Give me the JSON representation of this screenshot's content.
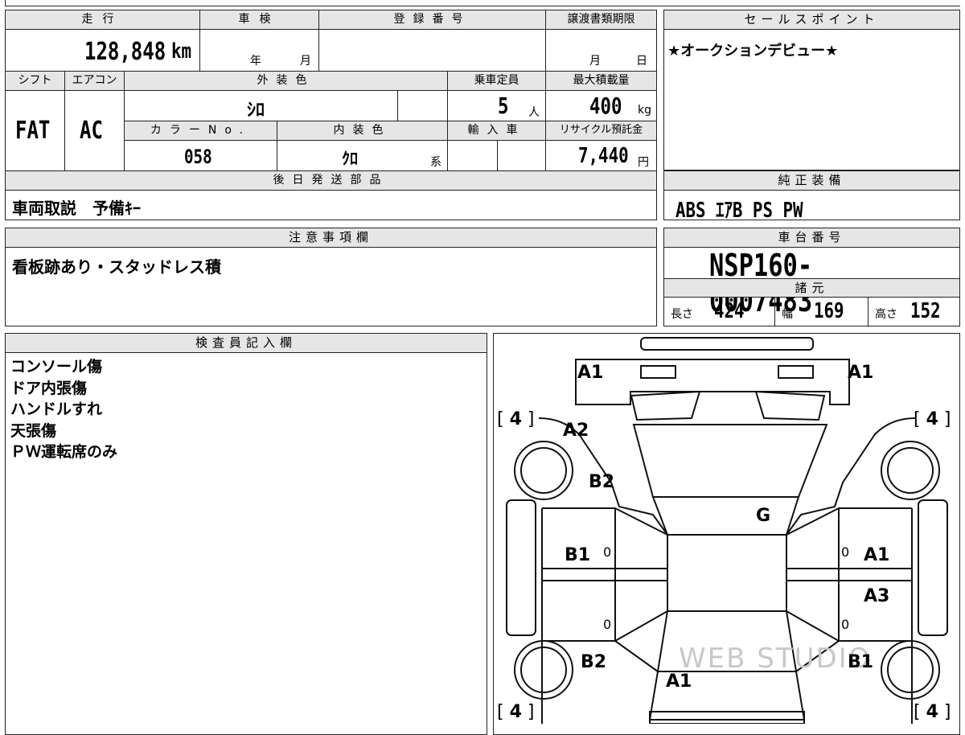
{
  "top_strip": {},
  "info": {
    "mileage_label": "走行",
    "mileage_value": "128,848",
    "mileage_unit": "km",
    "shaken_label": "車検",
    "shaken_year": "年",
    "shaken_month": "月",
    "reg_label": "登録番号",
    "transfer_label": "譲渡書類期限",
    "transfer_month": "月",
    "transfer_day": "日",
    "shift_label": "シフト",
    "shift_value": "FAT",
    "ac_label": "エアコン",
    "ac_value": "AC",
    "ext_color_label": "外装色",
    "ext_color_value": "ｼﾛ",
    "capacity_label": "乗車定員",
    "capacity_value": "5",
    "capacity_unit": "人",
    "load_label": "最大積載量",
    "load_value": "400",
    "load_unit": "kg",
    "color_no_label": "カラーNo.",
    "color_no_value": "058",
    "int_color_label": "内装色",
    "int_color_value": "ｸﾛ",
    "int_color_suffix": "系",
    "import_label": "輸入車",
    "recycle_label": "リサイクル預託金",
    "recycle_value": "7,440",
    "recycle_unit": "円",
    "later_parts_label": "後日発送部品",
    "later_parts_value": "車両取説　予備ｷｰ"
  },
  "sales": {
    "label": "セールスポイント",
    "value": "★オークションデビュー★"
  },
  "equipment": {
    "label": "純正装備",
    "value": "ABS ｴｱB PS PW"
  },
  "notes": {
    "label": "注意事項欄",
    "value": "看板跡あり・スタッドレス積"
  },
  "chassis": {
    "label": "車台番号",
    "value": "NSP160-0007483",
    "spec_label": "諸元",
    "length_label": "長さ",
    "length_value": "424",
    "width_label": "幅",
    "width_value": "169",
    "height_label": "高さ",
    "height_value": "152"
  },
  "inspector": {
    "label": "検査員記入欄",
    "lines": [
      "コンソール傷",
      "ドア内張傷",
      "ハンドルすれ",
      "天張傷",
      "ＰＷ運転席のみ"
    ]
  },
  "diagram": {
    "marks": {
      "front_left": "A1",
      "front_right": "A1",
      "hood_left": "A2",
      "fender_left": "B2",
      "windshield": "G",
      "front_door_left": "B1",
      "front_door_right": "A1",
      "rear_door_right": "A3",
      "rear_fender_left": "B2",
      "rear_fender_right": "B1",
      "rear": "A1",
      "door_zero_1": "0",
      "door_zero_2": "0",
      "door_zero_3": "0",
      "door_zero_4": "0"
    },
    "tires": {
      "fl": "4",
      "fr": "4",
      "rl": "4",
      "rr": "4"
    },
    "watermark": "WEB STUDIO"
  }
}
